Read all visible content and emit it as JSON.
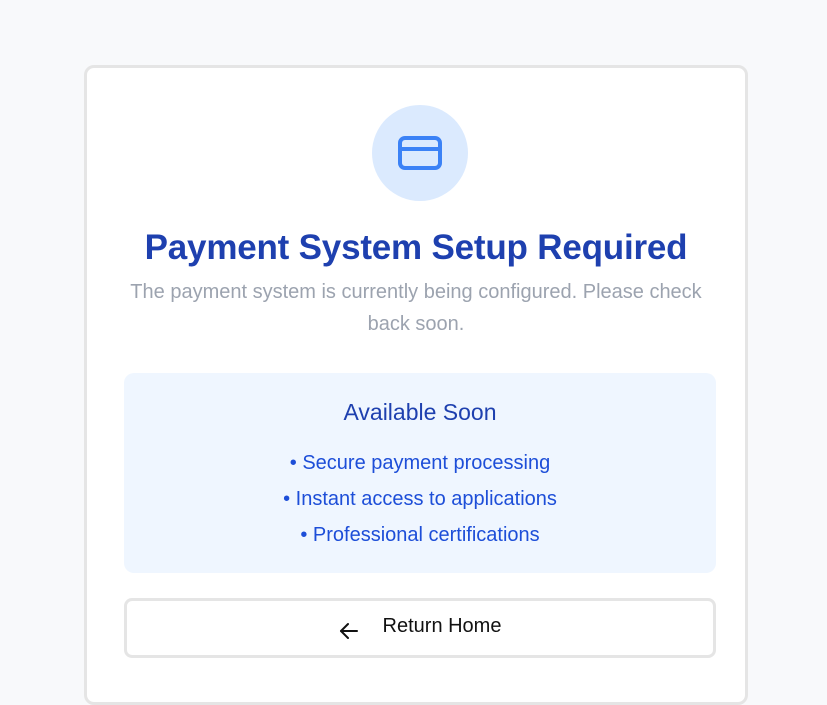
{
  "colors": {
    "page_background": "#f8f9fb",
    "title": "#1e40af",
    "subtitle": "#9ca3af",
    "icon_background": "#dbeafe",
    "icon_stroke": "#3b82f6",
    "info_background": "#eff6ff",
    "info_text": "#1d4ed8"
  },
  "card": {
    "icon": "credit-card-icon",
    "title": "Payment System Setup Required",
    "subtitle": "The payment system is currently being configured. Please check back soon."
  },
  "info_box": {
    "heading": "Available Soon",
    "items": [
      "• Secure payment processing",
      "• Instant access to applications",
      "• Professional certifications"
    ]
  },
  "return_button": {
    "icon": "arrow-left-icon",
    "label": "Return Home"
  }
}
